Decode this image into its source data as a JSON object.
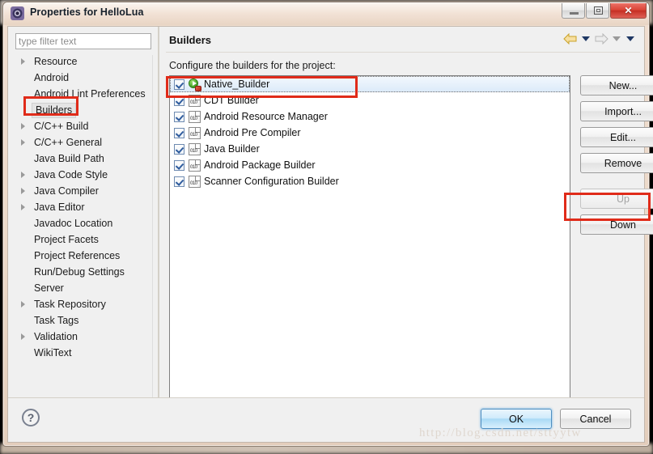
{
  "window": {
    "title": "Properties for HelloLua",
    "icon": "eclipse-gear-icon",
    "minimize_label": "",
    "maximize_label": "",
    "close_label": "✕"
  },
  "sidebar": {
    "filter": {
      "value": "",
      "placeholder": "type filter text"
    },
    "items": [
      {
        "label": "Resource",
        "expandable": true,
        "selected": false
      },
      {
        "label": "Android",
        "expandable": false,
        "selected": false
      },
      {
        "label": "Android Lint Preferences",
        "expandable": false,
        "selected": false
      },
      {
        "label": "Builders",
        "expandable": false,
        "selected": true
      },
      {
        "label": "C/C++ Build",
        "expandable": true,
        "selected": false
      },
      {
        "label": "C/C++ General",
        "expandable": true,
        "selected": false
      },
      {
        "label": "Java Build Path",
        "expandable": false,
        "selected": false
      },
      {
        "label": "Java Code Style",
        "expandable": true,
        "selected": false
      },
      {
        "label": "Java Compiler",
        "expandable": true,
        "selected": false
      },
      {
        "label": "Java Editor",
        "expandable": true,
        "selected": false
      },
      {
        "label": "Javadoc Location",
        "expandable": false,
        "selected": false
      },
      {
        "label": "Project Facets",
        "expandable": false,
        "selected": false
      },
      {
        "label": "Project References",
        "expandable": false,
        "selected": false
      },
      {
        "label": "Run/Debug Settings",
        "expandable": false,
        "selected": false
      },
      {
        "label": "Server",
        "expandable": false,
        "selected": false
      },
      {
        "label": "Task Repository",
        "expandable": true,
        "selected": false
      },
      {
        "label": "Task Tags",
        "expandable": false,
        "selected": false
      },
      {
        "label": "Validation",
        "expandable": true,
        "selected": false
      },
      {
        "label": "WikiText",
        "expandable": false,
        "selected": false
      }
    ]
  },
  "page": {
    "title": "Builders",
    "section_label": "Configure the builders for the project:",
    "nav": {
      "back_icon": "back-arrow-icon",
      "back_menu_icon": "chevron-down-icon",
      "forward_icon": "forward-arrow-icon",
      "forward_menu_icon": "chevron-down-icon",
      "view_menu_icon": "chevron-down-icon"
    }
  },
  "builders": [
    {
      "label": "Native_Builder",
      "checked": true,
      "selected": true,
      "icon": "native-builder-icon"
    },
    {
      "label": "CDT Builder",
      "checked": true,
      "selected": false,
      "icon": "builder-doc-icon"
    },
    {
      "label": "Android Resource Manager",
      "checked": true,
      "selected": false,
      "icon": "builder-doc-icon"
    },
    {
      "label": "Android Pre Compiler",
      "checked": true,
      "selected": false,
      "icon": "builder-doc-icon"
    },
    {
      "label": "Java Builder",
      "checked": true,
      "selected": false,
      "icon": "builder-doc-icon"
    },
    {
      "label": "Android Package Builder",
      "checked": true,
      "selected": false,
      "icon": "builder-doc-icon"
    },
    {
      "label": "Scanner Configuration Builder",
      "checked": true,
      "selected": false,
      "icon": "builder-doc-icon"
    }
  ],
  "side_buttons": [
    {
      "label": "New...",
      "enabled": true
    },
    {
      "label": "Import...",
      "enabled": true
    },
    {
      "label": "Edit...",
      "enabled": true
    },
    {
      "label": "Remove",
      "enabled": true
    },
    {
      "label": "Up",
      "enabled": false
    },
    {
      "label": "Down",
      "enabled": true
    }
  ],
  "footer": {
    "help_icon": "help-question-icon",
    "ok_label": "OK",
    "cancel_label": "Cancel"
  },
  "watermark": "http://blog.csdn.net/sttyytw",
  "colors": {
    "accent": "#e02b19",
    "ok_border": "#4f8fc0",
    "title_bar": "#ecd9c9"
  }
}
